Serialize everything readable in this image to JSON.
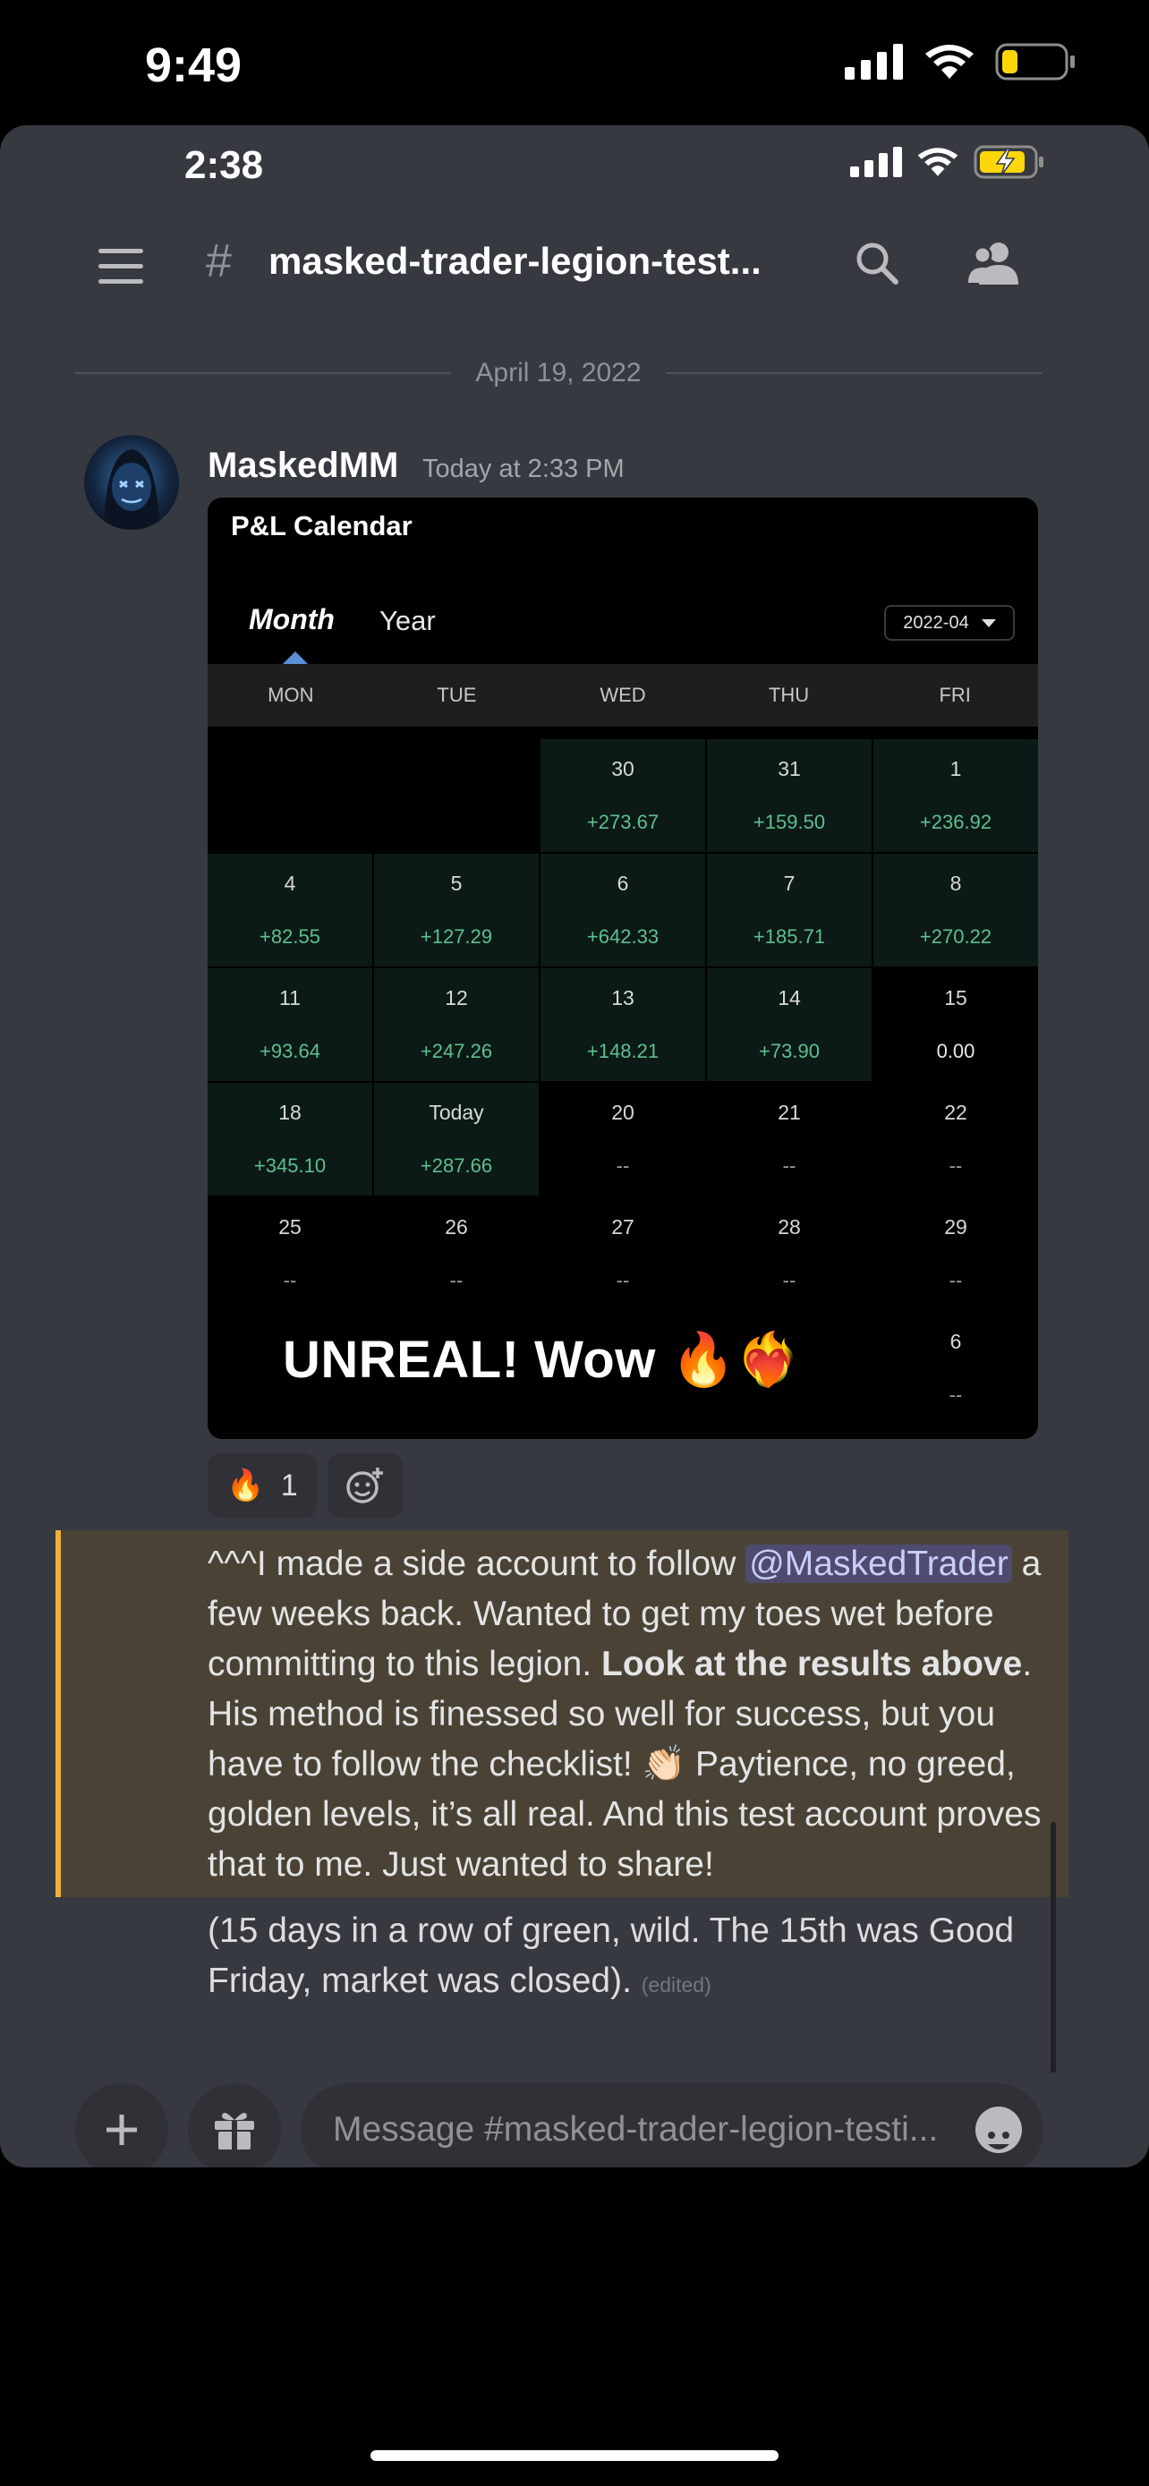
{
  "outer_status": {
    "time": "9:49"
  },
  "inner_status": {
    "time": "2:38"
  },
  "header": {
    "hash": "#",
    "channel_name": "masked-trader-legion-test..."
  },
  "date_divider": "April 19, 2022",
  "message": {
    "author": "MaskedMM",
    "timestamp": "Today at 2:33 PM"
  },
  "pl_calendar": {
    "title": "P&L Calendar",
    "tabs": {
      "month": "Month",
      "year": "Year"
    },
    "period": "2022-04",
    "weekdays": [
      "MON",
      "TUE",
      "WED",
      "THU",
      "FRI"
    ],
    "rows": [
      [
        {
          "d": "",
          "v": "",
          "g": false,
          "blank": true
        },
        {
          "d": "",
          "v": "",
          "g": false,
          "blank": true
        },
        {
          "d": "30",
          "v": "+273.67",
          "g": true
        },
        {
          "d": "31",
          "v": "+159.50",
          "g": true
        },
        {
          "d": "1",
          "v": "+236.92",
          "g": true
        }
      ],
      [
        {
          "d": "4",
          "v": "+82.55",
          "g": true
        },
        {
          "d": "5",
          "v": "+127.29",
          "g": true
        },
        {
          "d": "6",
          "v": "+642.33",
          "g": true
        },
        {
          "d": "7",
          "v": "+185.71",
          "g": true
        },
        {
          "d": "8",
          "v": "+270.22",
          "g": true
        }
      ],
      [
        {
          "d": "11",
          "v": "+93.64",
          "g": true
        },
        {
          "d": "12",
          "v": "+247.26",
          "g": true
        },
        {
          "d": "13",
          "v": "+148.21",
          "g": true
        },
        {
          "d": "14",
          "v": "+73.90",
          "g": true
        },
        {
          "d": "15",
          "v": "0.00",
          "g": false
        }
      ],
      [
        {
          "d": "18",
          "v": "+345.10",
          "g": true
        },
        {
          "d": "Today",
          "v": "+287.66",
          "g": true
        },
        {
          "d": "20",
          "v": "--",
          "g": false
        },
        {
          "d": "21",
          "v": "--",
          "g": false
        },
        {
          "d": "22",
          "v": "--",
          "g": false
        }
      ],
      [
        {
          "d": "25",
          "v": "--",
          "g": false
        },
        {
          "d": "26",
          "v": "--",
          "g": false
        },
        {
          "d": "27",
          "v": "--",
          "g": false
        },
        {
          "d": "28",
          "v": "--",
          "g": false
        },
        {
          "d": "29",
          "v": "--",
          "g": false
        }
      ],
      [
        {
          "d": "",
          "v": "",
          "g": false,
          "blank": true
        },
        {
          "d": "",
          "v": "",
          "g": false,
          "blank": true
        },
        {
          "d": "",
          "v": "",
          "g": false,
          "blank": true
        },
        {
          "d": "",
          "v": "",
          "g": false,
          "blank": true
        },
        {
          "d": "6",
          "v": "--",
          "g": false
        }
      ]
    ],
    "overlay_text": "UNREAL! Wow 🔥❤️‍🔥"
  },
  "reaction": {
    "emoji": "🔥",
    "count": "1"
  },
  "post": {
    "part1": "^^^I made a side account to follow ",
    "mention": "@MaskedTrader",
    "part2": " a few weeks back. Wanted to get my toes wet before committing to this legion. ",
    "bold": "Look at the results above",
    "part3": ". His method is finessed so well for success, but you have to follow the checklist! 👏🏻 Paytience, no greed, golden levels, it’s all real. And this test account proves that to me. Just wanted to share!",
    "followup": "(15 days in a row of green, wild. The 15th was Good Friday, market was closed). ",
    "edited": "(edited)"
  },
  "composer": {
    "placeholder": "Message #masked-trader-legion-testi..."
  }
}
